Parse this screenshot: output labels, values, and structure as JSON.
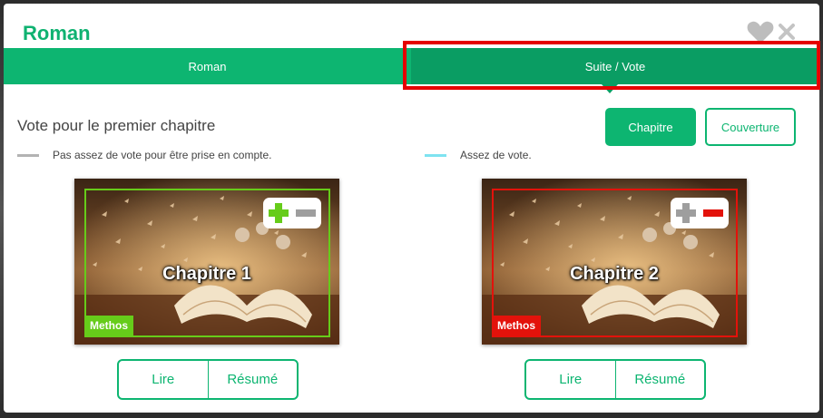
{
  "modal": {
    "title": "Roman"
  },
  "tabs": [
    {
      "label": "Roman",
      "active": false
    },
    {
      "label": "Suite / Vote",
      "active": true
    }
  ],
  "section_title": "Vote pour le premier chapitre",
  "filter_buttons": {
    "chapitre": "Chapitre",
    "couverture": "Couverture"
  },
  "legend": [
    {
      "label": "Pas assez de vote pour être prise en compte.",
      "color": "#b3b3b3"
    },
    {
      "label": "Assez de vote.",
      "color": "#7ee3f0"
    }
  ],
  "cards": [
    {
      "title": "Chapitre 1",
      "author": "Methos",
      "accent": "#66cc1a",
      "vote_state": "plus",
      "actions": {
        "read": "Lire",
        "summary": "Résumé"
      }
    },
    {
      "title": "Chapitre 2",
      "author": "Methos",
      "accent": "#e3120b",
      "vote_state": "minus",
      "actions": {
        "read": "Lire",
        "summary": "Résumé"
      }
    }
  ],
  "colors": {
    "brand_green": "#0db571",
    "active_tab": "#0a9d63",
    "highlight_red": "#e60000",
    "vote_plus": "#66cc1a",
    "vote_minus": "#e3120b",
    "vote_neutral": "#9e9e9e"
  }
}
